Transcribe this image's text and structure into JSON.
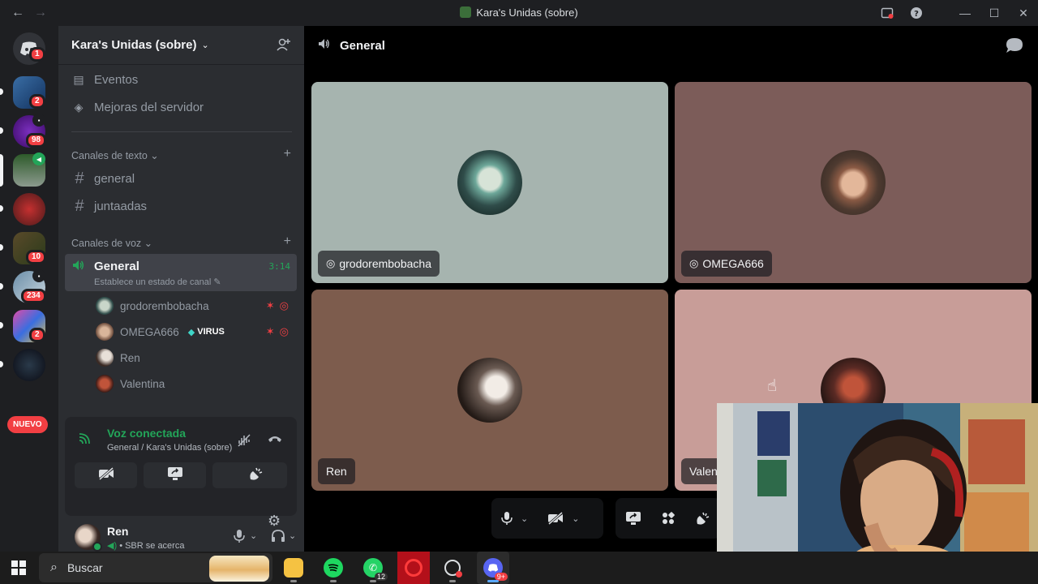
{
  "titlebar": {
    "back": "←",
    "forward": "→",
    "title": "Kara's Unidas (sobre)"
  },
  "rail": {
    "home_badge": "1",
    "badges": [
      "2",
      "98",
      "10",
      "234",
      "2"
    ],
    "nuevo": "NUEVO"
  },
  "sidebar": {
    "server_name": "Kara's Unidas (sobre)",
    "menu": [
      {
        "label": "Eventos",
        "icon": "calendar-icon"
      },
      {
        "label": "Mejoras del servidor",
        "icon": "boost-icon"
      }
    ],
    "text_category": "Canales de texto",
    "text_channels": [
      "general",
      "juntaadas"
    ],
    "voice_category": "Canales de voz",
    "voice_channel": {
      "name": "General",
      "status_placeholder": "Establece un estado de canal",
      "timer": "3:14"
    },
    "voice_users": [
      {
        "name": "grodorembobacha",
        "avatar_color": "#3b5e5a"
      },
      {
        "name": "OMEGA666",
        "avatar_color": "#8a6b5a",
        "tag": "VIRUS"
      },
      {
        "name": "Ren",
        "avatar_color": "#5a4a44"
      },
      {
        "name": "Valentina",
        "avatar_color": "#7a3a32"
      }
    ]
  },
  "voice_panel": {
    "title": "Voz conectada",
    "subtitle": "General / Kara's Unidas (sobre)"
  },
  "user_panel": {
    "name": "Ren",
    "status": "• SBR se acerca"
  },
  "main": {
    "channel": "General",
    "tiles": [
      {
        "name": "grodorembobacha",
        "bg": "#a6b4af",
        "avatar": "#2f4c49"
      },
      {
        "name": "OMEGA666",
        "bg": "#7c5c59",
        "avatar": "#a88772"
      },
      {
        "name": "Ren",
        "bg": "#7d5c4d",
        "avatar": "#4a3a34"
      },
      {
        "name": "Valen",
        "bg": "#c89d98",
        "avatar": "#5a2a24"
      }
    ]
  },
  "taskbar": {
    "search": "Buscar",
    "whatsapp_count": "12",
    "discord_count": "9+"
  },
  "colors": {
    "accent_green": "#23a559",
    "danger": "#f23f43",
    "sidebar_bg": "#2b2d31"
  }
}
